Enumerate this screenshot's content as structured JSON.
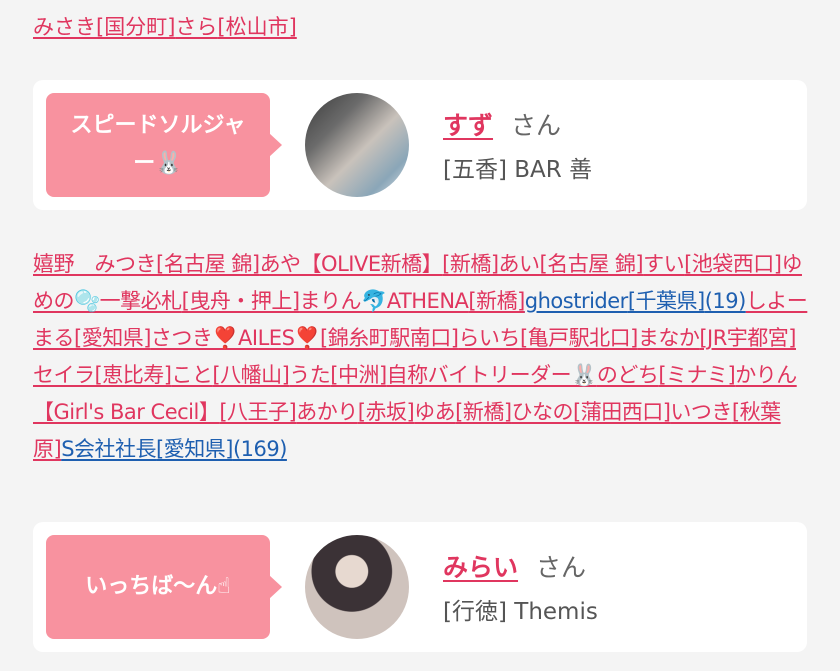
{
  "top_links": [
    {
      "text": "みさき",
      "color": "pink"
    },
    {
      "text": "[国分町]",
      "color": "pink"
    },
    {
      "text": "さら",
      "color": "pink"
    },
    {
      "text": "[松山市]",
      "color": "pink"
    }
  ],
  "cards": [
    {
      "bubble_line1": "スピードソルジャ",
      "bubble_line2": "ー🐰",
      "name": "すず",
      "honorific": "さん",
      "area": "[五香]",
      "shop": "BAR 善"
    },
    {
      "bubble_line1": "いっちば〜ん☝",
      "bubble_line2": "",
      "name": "みらい",
      "honorific": "さん",
      "area": "[行徳]",
      "shop": "Themis"
    }
  ],
  "cloud_links": [
    {
      "text": "嬉野　みつき",
      "color": "pink"
    },
    {
      "text": "[名古屋 錦]",
      "color": "pink"
    },
    {
      "text": "あや【OLIVE新橋】",
      "color": "pink"
    },
    {
      "text": "[新橋]",
      "color": "pink"
    },
    {
      "text": "あい",
      "color": "pink"
    },
    {
      "text": "[名古屋 錦]",
      "color": "pink"
    },
    {
      "text": "すい",
      "color": "pink"
    },
    {
      "text": "[池袋西口]",
      "color": "pink"
    },
    {
      "text": "ゆめの🫧一撃必札",
      "color": "pink"
    },
    {
      "text": "[曳舟・押上]",
      "color": "pink"
    },
    {
      "text": "まりん🐬ATHENA",
      "color": "pink"
    },
    {
      "text": "[新橋]",
      "color": "pink"
    },
    {
      "text": "ghostrider",
      "color": "blue"
    },
    {
      "text": "[千葉県]",
      "color": "blue"
    },
    {
      "text": "(19)",
      "color": "blue"
    },
    {
      "text": "しよーまる",
      "color": "pink"
    },
    {
      "text": "[愛知県]",
      "color": "pink"
    },
    {
      "text": "さつき❣️AILES❣️",
      "color": "pink"
    },
    {
      "text": "[錦糸町駅南口]",
      "color": "pink"
    },
    {
      "text": "らいち",
      "color": "pink"
    },
    {
      "text": "[亀戸駅北口]",
      "color": "pink"
    },
    {
      "text": "まなか",
      "color": "pink"
    },
    {
      "text": "[JR宇都宮]",
      "color": "pink"
    },
    {
      "text": "セイラ",
      "color": "pink"
    },
    {
      "text": "[恵比寿]",
      "color": "pink"
    },
    {
      "text": "こと",
      "color": "pink"
    },
    {
      "text": "[八幡山]",
      "color": "pink"
    },
    {
      "text": "うた",
      "color": "pink"
    },
    {
      "text": "[中洲]",
      "color": "pink"
    },
    {
      "text": "自称バイトリーダー🐰",
      "color": "pink"
    },
    {
      "text": "のどち",
      "color": "pink"
    },
    {
      "text": "[ミナミ]",
      "color": "pink"
    },
    {
      "text": "かりん【Girl's Bar Cecil】",
      "color": "pink"
    },
    {
      "text": "[八王子]",
      "color": "pink"
    },
    {
      "text": "あかり",
      "color": "pink"
    },
    {
      "text": "[赤坂]",
      "color": "pink"
    },
    {
      "text": "ゆあ",
      "color": "pink"
    },
    {
      "text": "[新橋]",
      "color": "pink"
    },
    {
      "text": "ひなの",
      "color": "pink"
    },
    {
      "text": "[蒲田西口]",
      "color": "pink"
    },
    {
      "text": "いつき",
      "color": "pink"
    },
    {
      "text": "[秋葉原]",
      "color": "pink"
    },
    {
      "text": "S会社社長",
      "color": "blue"
    },
    {
      "text": "[愛知県]",
      "color": "blue"
    },
    {
      "text": "(169)",
      "color": "blue"
    }
  ],
  "colors": {
    "accent": "#e0365f",
    "link_blue": "#1e5fb0",
    "bubble": "#f8929f",
    "bg": "#f4f4f4"
  }
}
